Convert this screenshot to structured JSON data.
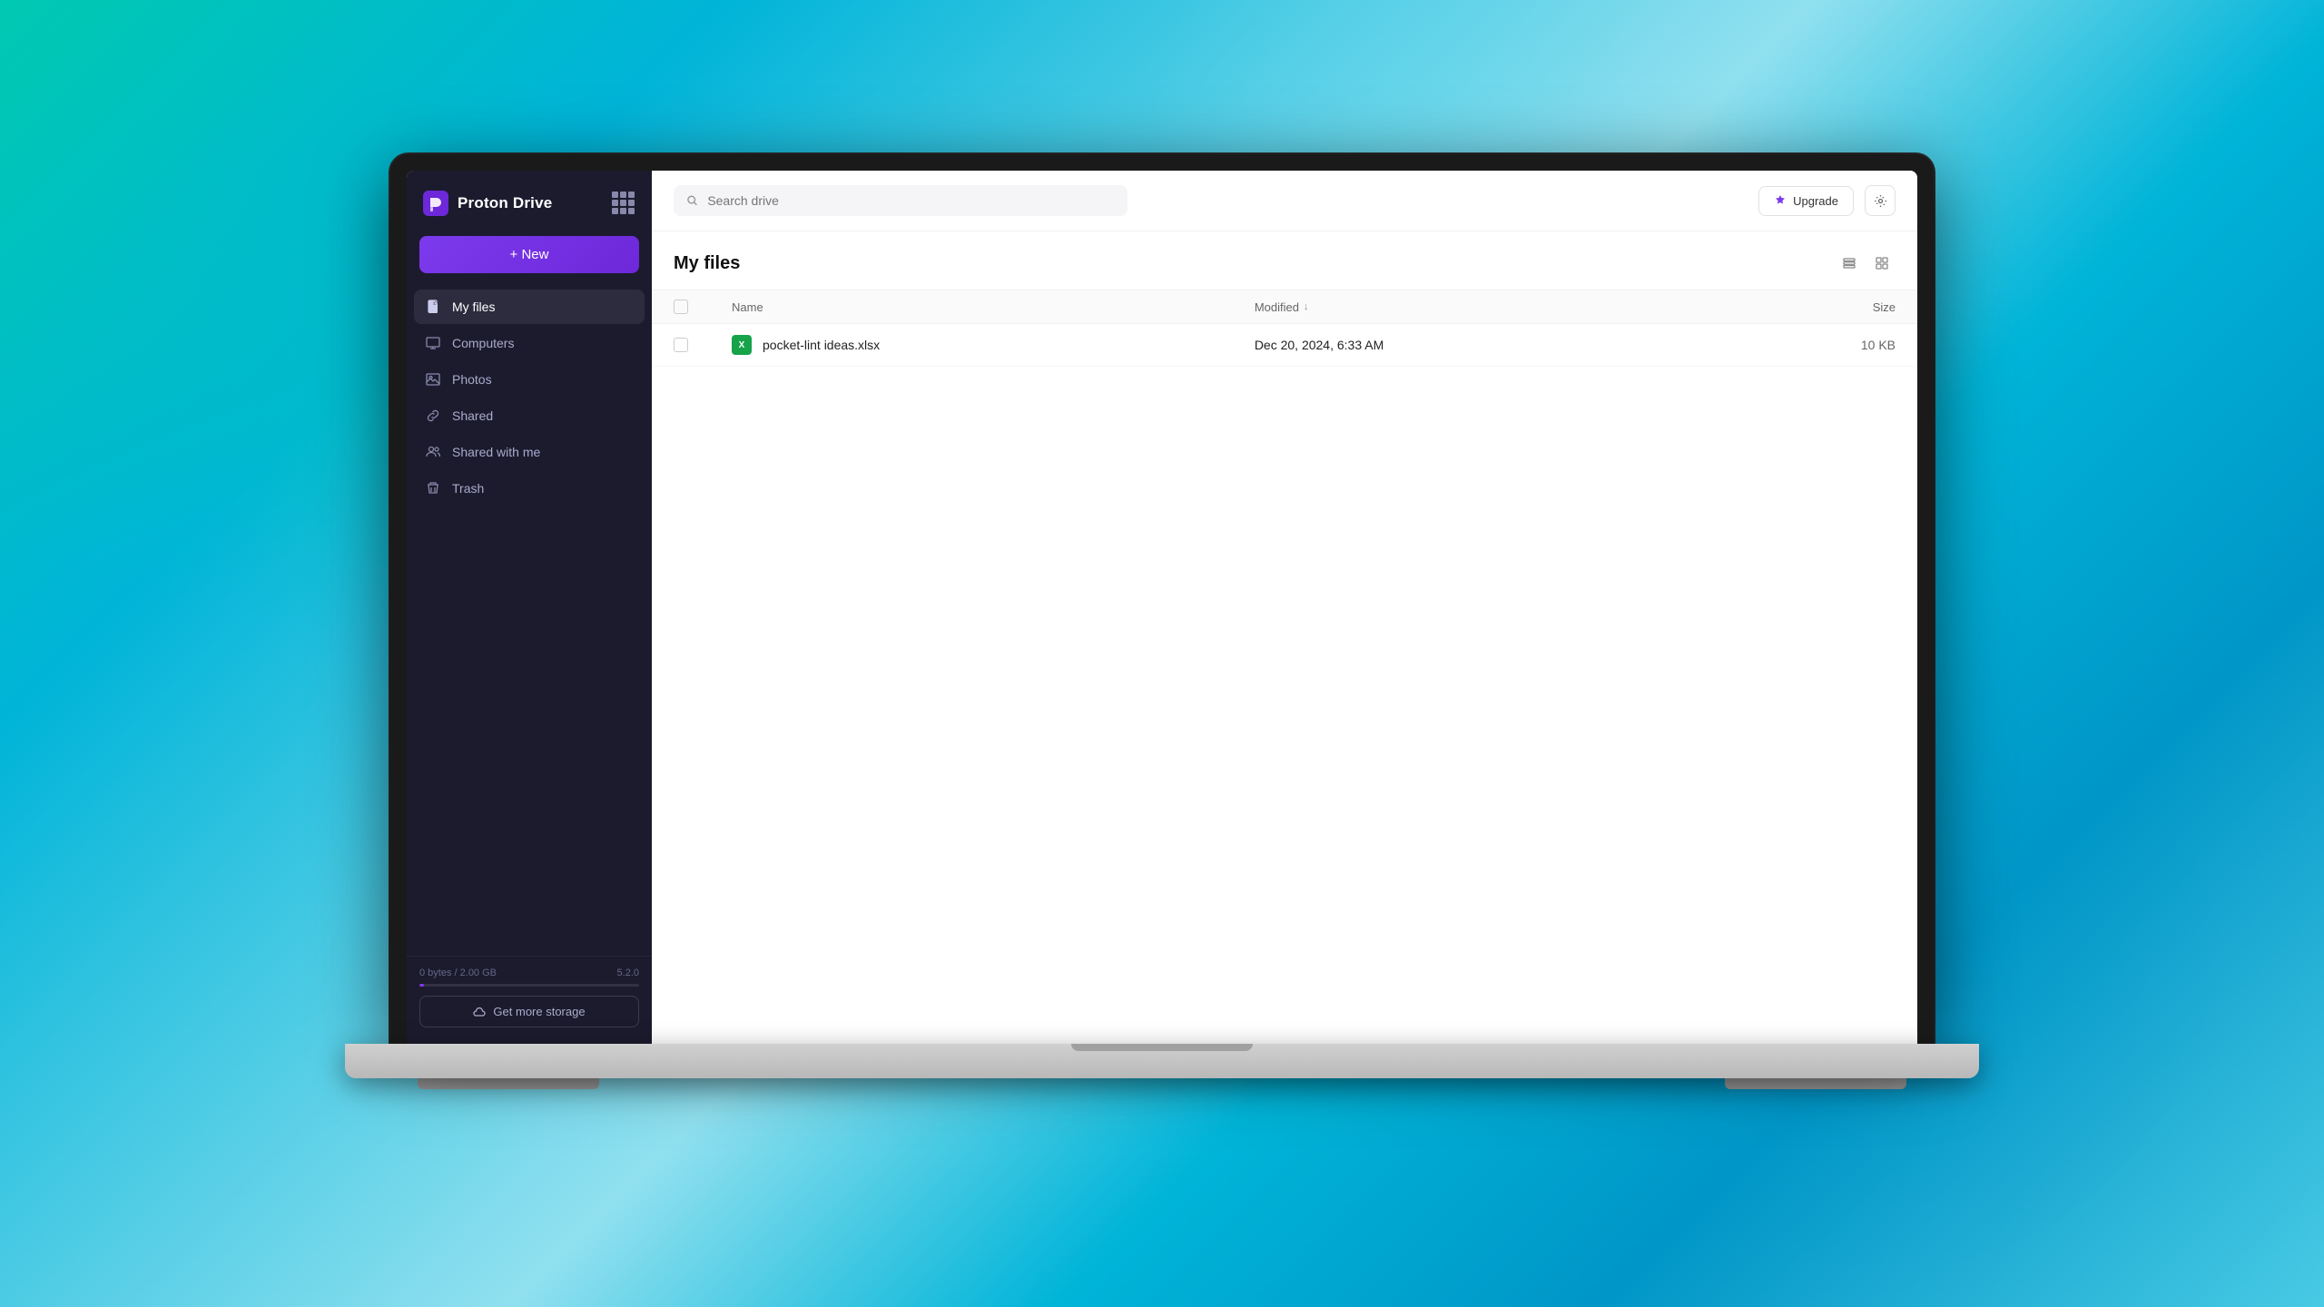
{
  "app": {
    "name": "Proton Drive",
    "logo_alt": "Proton Drive logo"
  },
  "topbar": {
    "search_placeholder": "Search drive",
    "upgrade_label": "Upgrade",
    "settings_label": "Settings"
  },
  "sidebar": {
    "new_button_label": "+ New",
    "nav_items": [
      {
        "id": "my-files",
        "label": "My files",
        "active": true,
        "icon": "file-icon"
      },
      {
        "id": "computers",
        "label": "Computers",
        "active": false,
        "icon": "monitor-icon"
      },
      {
        "id": "photos",
        "label": "Photos",
        "active": false,
        "icon": "photo-icon"
      },
      {
        "id": "shared",
        "label": "Shared",
        "active": false,
        "icon": "link-icon"
      },
      {
        "id": "shared-with-me",
        "label": "Shared with me",
        "active": false,
        "icon": "people-icon"
      },
      {
        "id": "trash",
        "label": "Trash",
        "active": false,
        "icon": "trash-icon"
      }
    ],
    "storage_used": "0 bytes",
    "storage_total": "2.00 GB",
    "storage_version": "5.2.0",
    "get_storage_label": "Get more storage"
  },
  "main": {
    "title": "My files",
    "columns": {
      "name": "Name",
      "modified": "Modified",
      "size": "Size"
    },
    "files": [
      {
        "name": "pocket-lint ideas.xlsx",
        "modified": "Dec 20, 2024, 6:33 AM",
        "size": "10 KB",
        "type": "xlsx"
      }
    ]
  }
}
